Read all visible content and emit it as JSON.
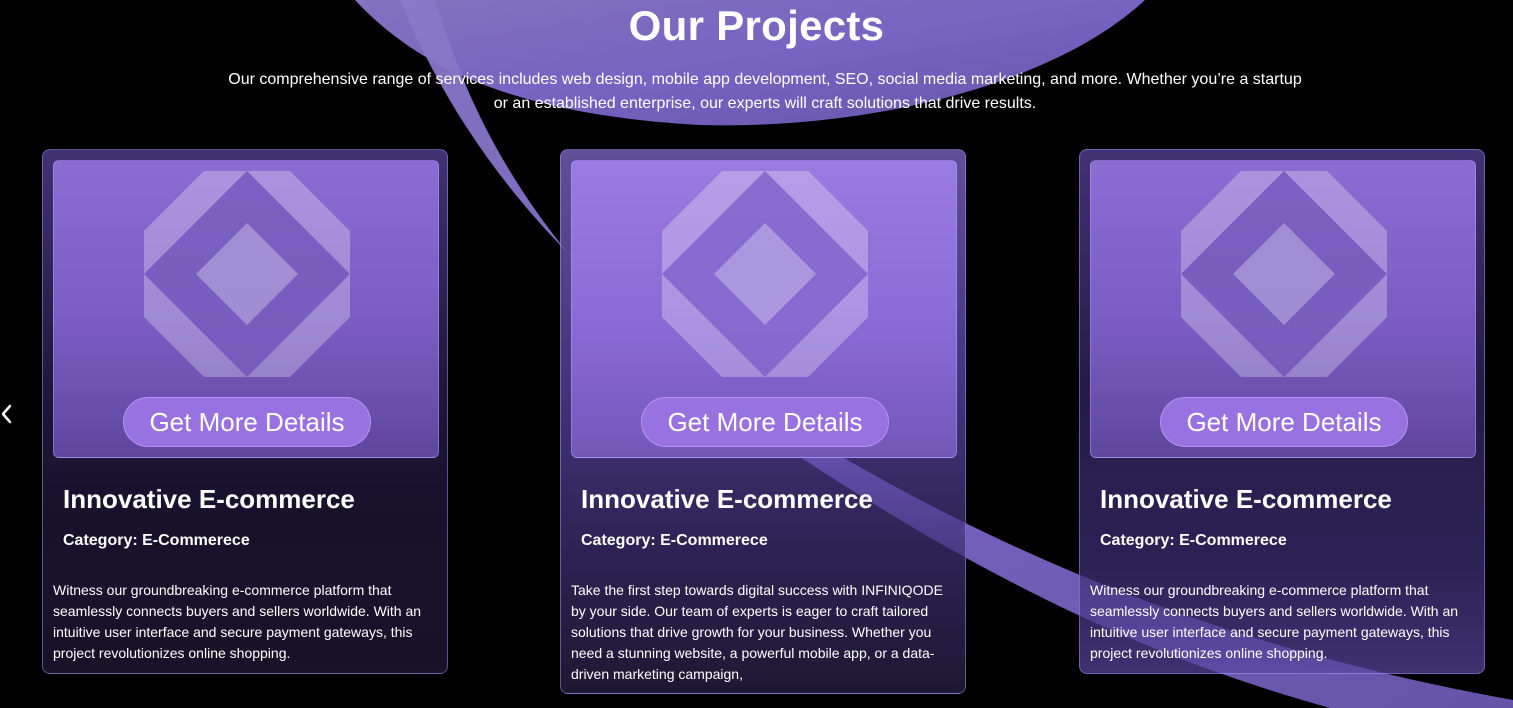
{
  "section": {
    "title": "Our Projects",
    "subtitle": "Our comprehensive range of services includes web design, mobile app development, SEO, social media marketing, and more. Whether you’re a startup or an established enterprise, our experts will craft solutions that drive results."
  },
  "carousel": {
    "prev_icon": "chevron-left-icon"
  },
  "cards": [
    {
      "button_label": "Get More Details",
      "title": "Innovative E-commerce",
      "category": "Category: E-Commerece",
      "description": "Witness our groundbreaking e-commerce platform that seamlessly connects buyers and sellers worldwide. With an intuitive user interface and secure payment gateways, this project revolutionizes online shopping."
    },
    {
      "button_label": "Get More Details",
      "title": "Innovative E-commerce",
      "category": "Category: E-Commerece",
      "description": "Take the first step towards digital success with INFINIQODE by your side. Our team of experts is eager to craft tailored solutions that drive growth for your business. Whether you need a stunning website, a powerful mobile app, or a data-driven marketing campaign,"
    },
    {
      "button_label": "Get More Details",
      "title": "Innovative E-commerce",
      "category": "Category: E-Commerece",
      "description": "Witness our groundbreaking e-commerce platform that seamlessly connects buyers and sellers worldwide. With an intuitive user interface and secure payment gateways, this project revolutionizes online shopping."
    }
  ],
  "colors": {
    "background": "#000000",
    "accent": "#9872e0",
    "swoosh": "#7a62c8"
  }
}
